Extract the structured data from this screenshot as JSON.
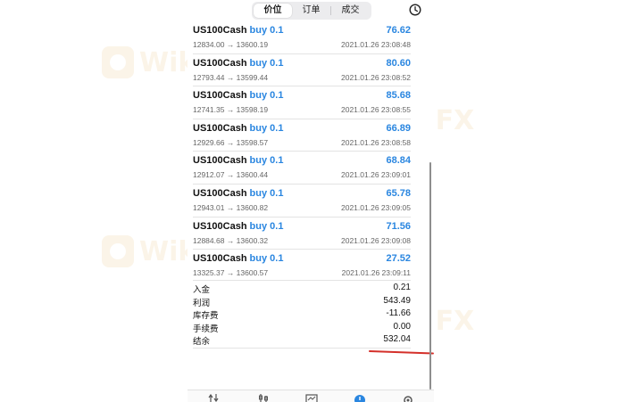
{
  "tabs": [
    {
      "label": "价位",
      "active": true
    },
    {
      "label": "订单",
      "active": false
    },
    {
      "label": "成交",
      "active": false
    }
  ],
  "history_icon": "clock-history-icon",
  "trades": [
    {
      "symbol": "US100Cash",
      "action": "buy 0.1",
      "prices": "12834.00 → 13600.19",
      "profit": "76.62",
      "time": "2021.01.26 23:08:48"
    },
    {
      "symbol": "US100Cash",
      "action": "buy 0.1",
      "prices": "12793.44 → 13599.44",
      "profit": "80.60",
      "time": "2021.01.26 23:08:52"
    },
    {
      "symbol": "US100Cash",
      "action": "buy 0.1",
      "prices": "12741.35 → 13598.19",
      "profit": "85.68",
      "time": "2021.01.26 23:08:55"
    },
    {
      "symbol": "US100Cash",
      "action": "buy 0.1",
      "prices": "12929.66 → 13598.57",
      "profit": "66.89",
      "time": "2021.01.26 23:08:58"
    },
    {
      "symbol": "US100Cash",
      "action": "buy 0.1",
      "prices": "12912.07 → 13600.44",
      "profit": "68.84",
      "time": "2021.01.26 23:09:01"
    },
    {
      "symbol": "US100Cash",
      "action": "buy 0.1",
      "prices": "12943.01 → 13600.82",
      "profit": "65.78",
      "time": "2021.01.26 23:09:05"
    },
    {
      "symbol": "US100Cash",
      "action": "buy 0.1",
      "prices": "12884.68 → 13600.32",
      "profit": "71.56",
      "time": "2021.01.26 23:09:08"
    },
    {
      "symbol": "US100Cash",
      "action": "buy 0.1",
      "prices": "13325.37 → 13600.57",
      "profit": "27.52",
      "time": "2021.01.26 23:09:11"
    }
  ],
  "summary": [
    {
      "label": "入金",
      "value": "0.21"
    },
    {
      "label": "利润",
      "value": "543.49"
    },
    {
      "label": "库存费",
      "value": "-11.66"
    },
    {
      "label": "手续费",
      "value": "0.00"
    },
    {
      "label": "结余",
      "value": "532.04"
    }
  ],
  "watermark": "WikiFX",
  "tabbar_icons": [
    "quotes-icon",
    "chart-icon",
    "trade-icon",
    "history-icon",
    "settings-icon"
  ],
  "colors": {
    "accent": "#2a86e0",
    "annotation": "#d4302a",
    "watermark": "#e0a84a"
  }
}
